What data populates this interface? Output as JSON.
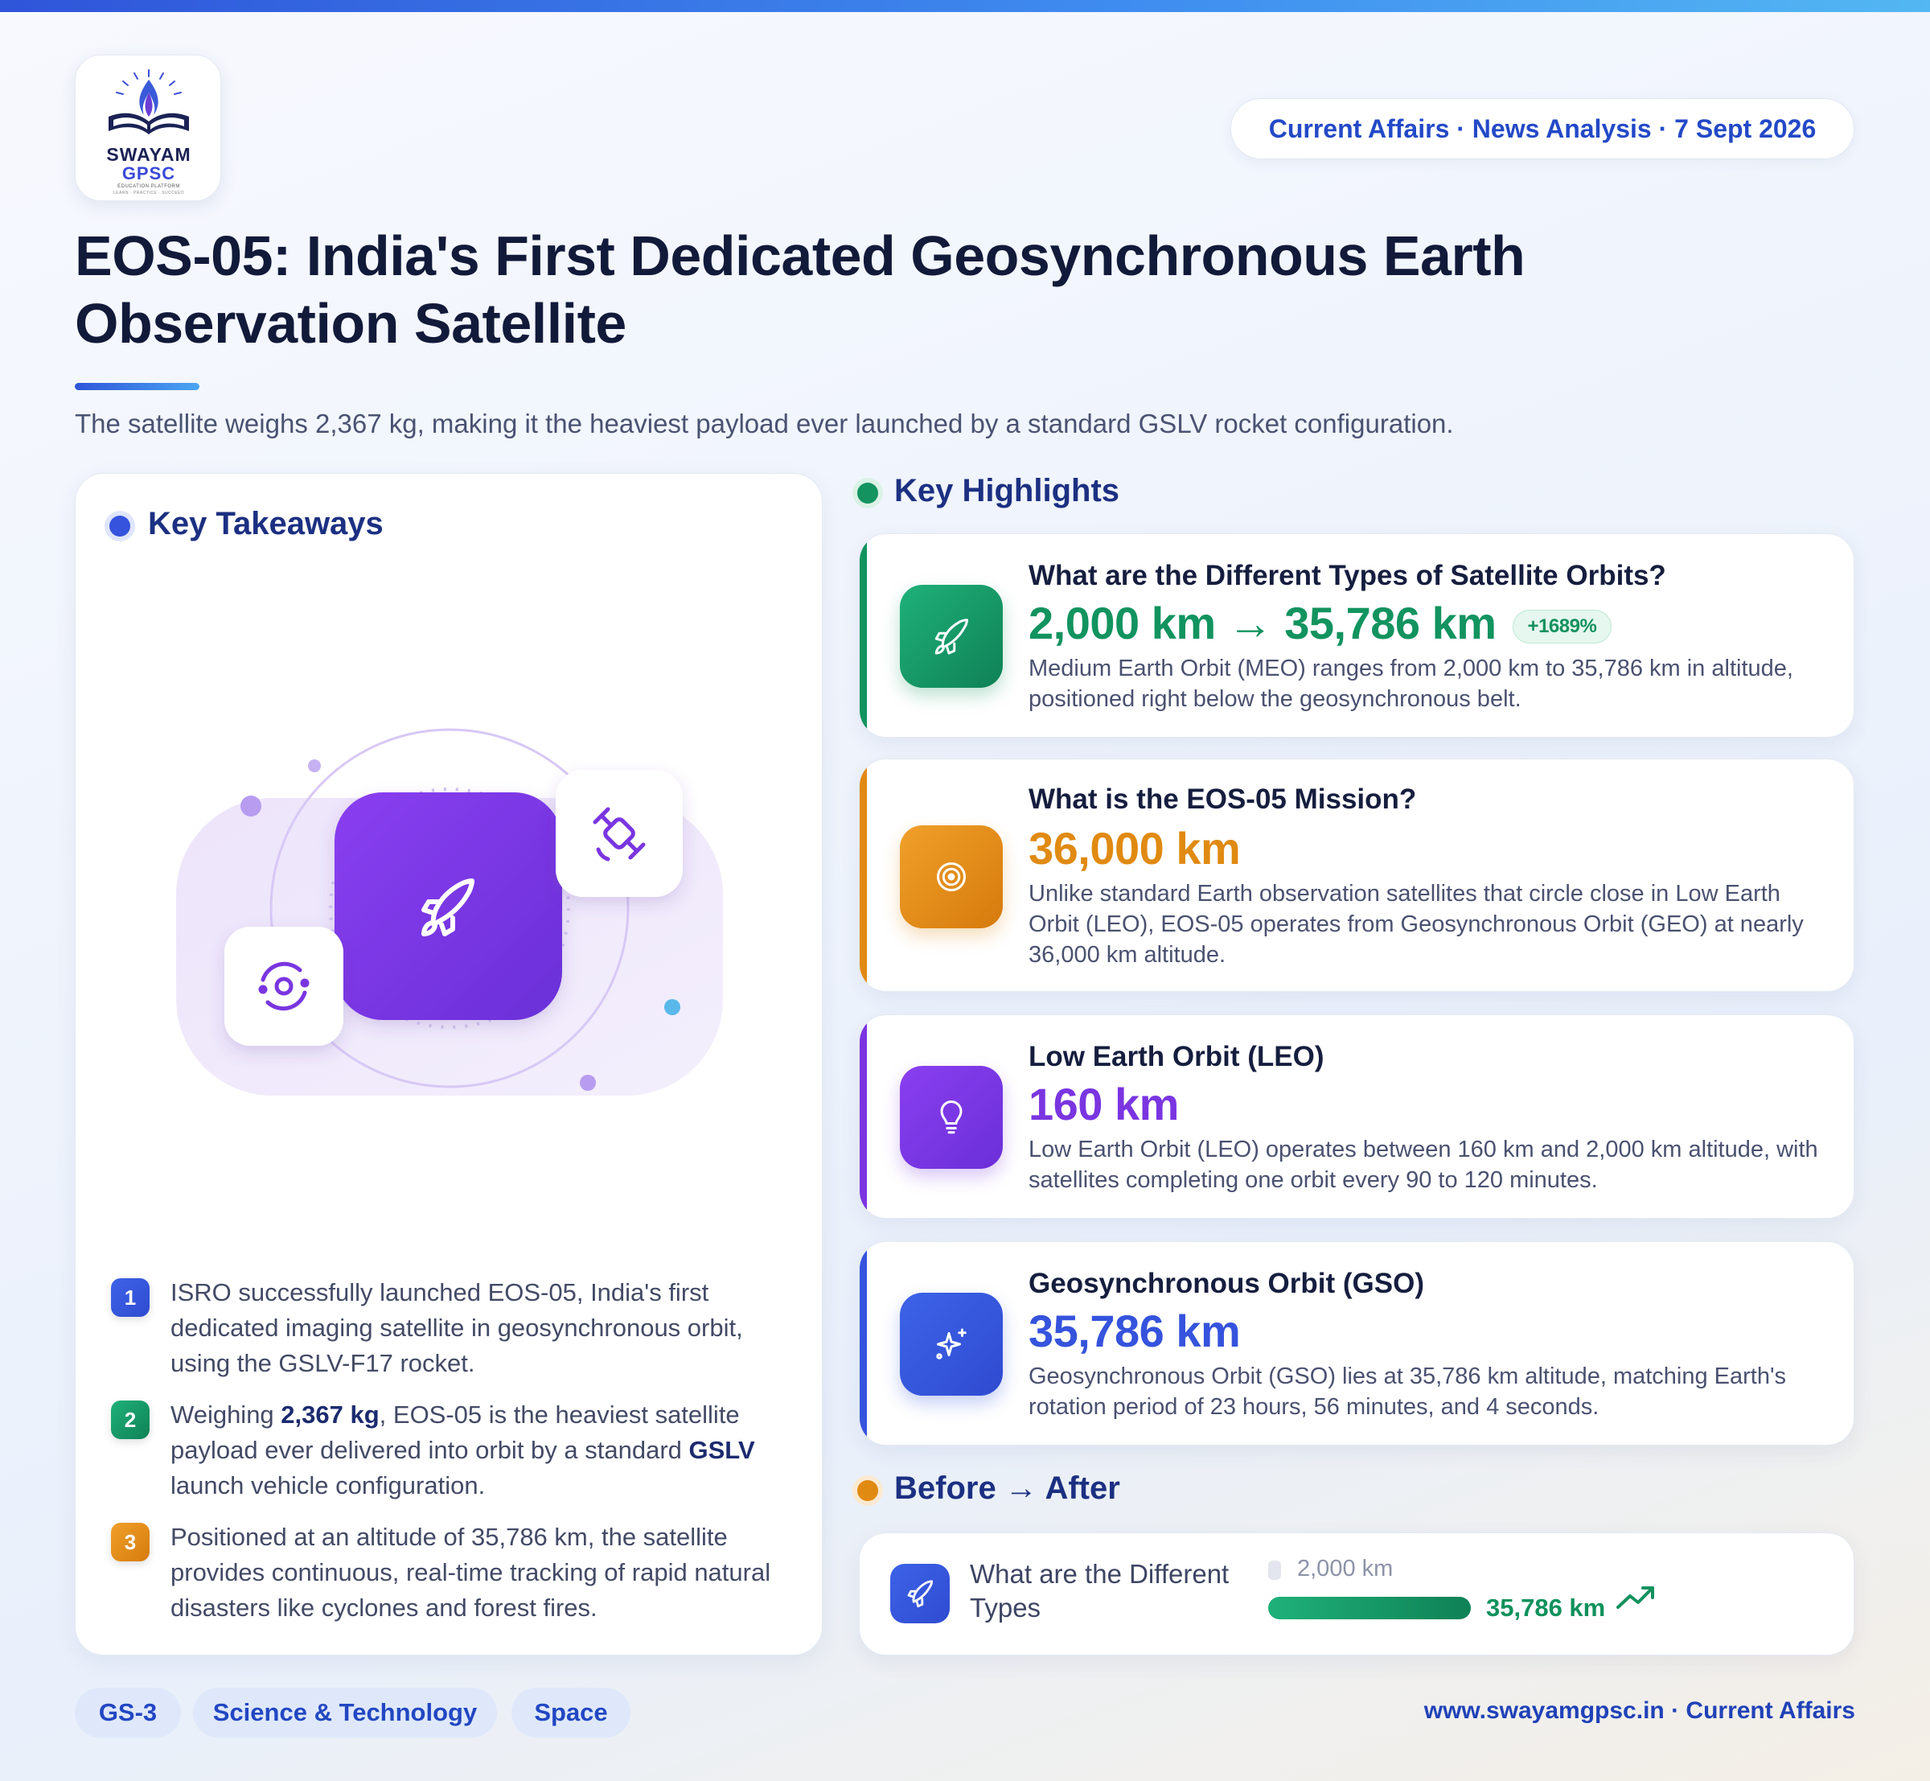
{
  "brand": {
    "name_line1": "SWAYAM",
    "name_line2": "GPSC",
    "tagline": "EDUCATION PLATFORM",
    "motto": "LEARN · PRACTICE · SUCCEED"
  },
  "header": {
    "date_pill": "Current Affairs · News Analysis · 7 Sept 2026",
    "title_line1": "EOS-05: India's First Dedicated Geosynchronous Earth",
    "title_line2": "Observation Satellite",
    "subtitle": "The satellite weighs 2,367 kg, making it the heaviest payload ever launched by a standard GSLV rocket configuration."
  },
  "takeaways": {
    "heading": "Key Takeaways",
    "items": [
      {
        "num": "1",
        "text": "ISRO successfully launched EOS-05, India's first dedicated imaging satellite in geosynchronous orbit, using the GSLV-F17 rocket."
      },
      {
        "num": "2",
        "pre": "Weighing ",
        "bold1": "2,367 kg",
        "mid": ", EOS-05 is the heaviest satellite payload ever delivered into orbit by a standard ",
        "bold2": "GSLV",
        "post": " launch vehicle configuration."
      },
      {
        "num": "3",
        "text": "Positioned at an altitude of 35,786 km, the satellite provides continuous, real-time tracking of rapid natural disasters like cyclones and forest fires."
      }
    ]
  },
  "highlights": {
    "heading": "Key Highlights",
    "items": [
      {
        "question": "What are the Different Types of Satellite Orbits?",
        "value_from": "2,000 km",
        "arrow": "→",
        "value_to": "35,786 km",
        "change": "+1689%",
        "desc": "Medium Earth Orbit (MEO) ranges from 2,000 km to 35,786 km in altitude, positioned right below the geosynchronous belt.",
        "icon": "rocket-icon",
        "color": "#12935f"
      },
      {
        "question": "What is the EOS-05 Mission?",
        "value": "36,000 km",
        "desc": "Unlike standard Earth observation satellites that circle close in Low Earth Orbit (LEO), EOS-05 operates from Geosynchronous Orbit (GEO) at nearly 36,000 km altitude.",
        "icon": "target-icon",
        "color": "#e08a12"
      },
      {
        "question": "Low Earth Orbit (LEO)",
        "value": "160 km",
        "desc": "Low Earth Orbit (LEO) operates between 160 km and 2,000 km altitude, with satellites completing one orbit every 90 to 120 minutes.",
        "icon": "lightbulb-icon",
        "color": "#7a35e0"
      },
      {
        "question": "Geosynchronous Orbit (GSO)",
        "value": "35,786 km",
        "desc": "Geosynchronous Orbit (GSO) lies at 35,786 km altitude, matching Earth's rotation period of 23 hours, 56 minutes, and 4 seconds.",
        "icon": "sparkles-icon",
        "color": "#3553dc"
      }
    ]
  },
  "before_after": {
    "heading": "Before → After",
    "label": "What are the Different Types",
    "before": "2,000 km",
    "after": "35,786 km",
    "before_fraction": 0.056
  },
  "footer": {
    "tags": [
      "GS-3",
      "Science & Technology",
      "Space"
    ],
    "url": "www.swayamgpsc.in · Current Affairs"
  },
  "colors": {
    "primary_blue": "#2349c7",
    "green": "#12935f",
    "orange": "#e08a12",
    "purple": "#7a35e0",
    "indigo": "#3553dc"
  }
}
